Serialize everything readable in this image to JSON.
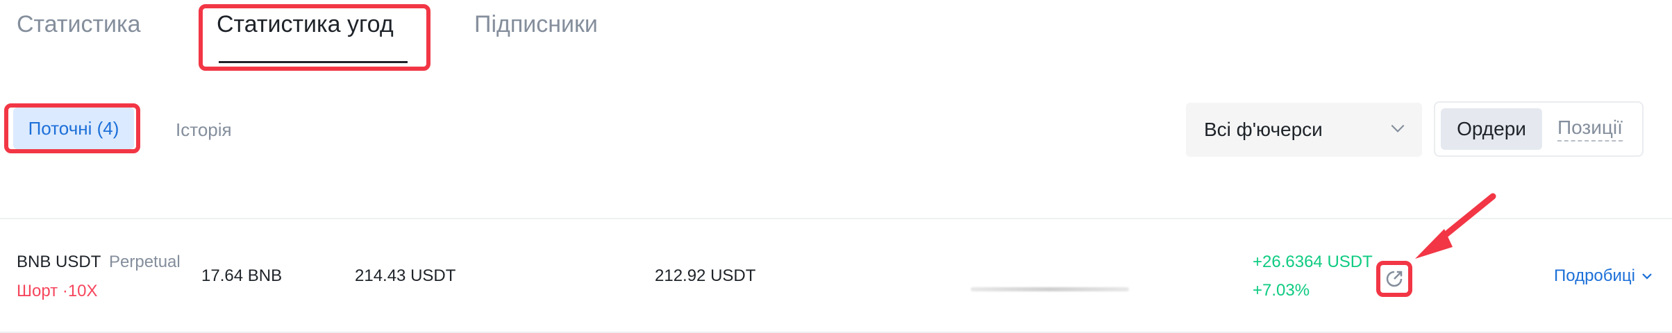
{
  "tabs": {
    "stats": "Статистика",
    "trade_stats": "Статистика угод",
    "subscribers": "Підписники"
  },
  "subtabs": {
    "current": "Поточні (4)",
    "history": "Історія"
  },
  "filter": {
    "selected": "Всі ф'ючерси"
  },
  "segment": {
    "orders": "Ордери",
    "positions": "Позиції"
  },
  "row": {
    "symbol": "BNB USDT",
    "type": "Perpetual",
    "side": "Шорт ·10X",
    "quantity": "17.64 BNB",
    "entry_price": "214.43 USDT",
    "mark_price": "212.92 USDT",
    "pnl": "+26.6364 USDT",
    "pnl_percent": "+7.03%",
    "details": "Подробиці"
  },
  "colors": {
    "accent": "#1c6fd8",
    "highlight": "#f23645",
    "short": "#f6465d",
    "profit": "#0ecb81"
  }
}
